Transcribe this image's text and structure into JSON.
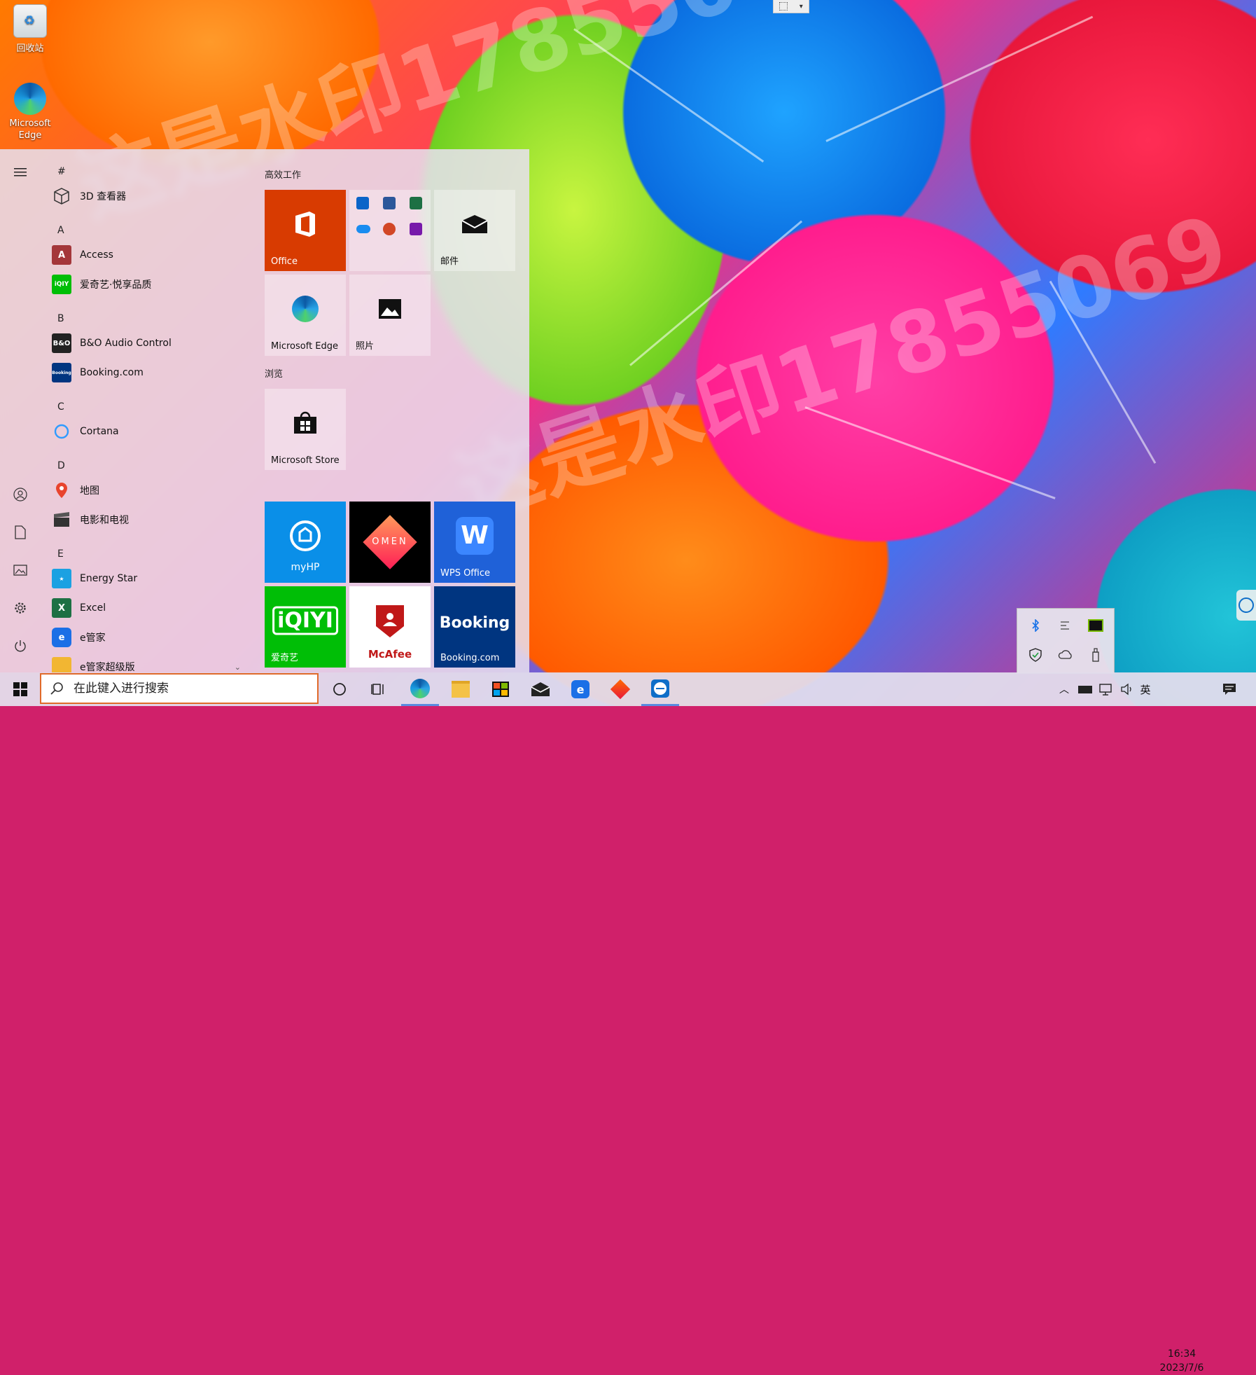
{
  "desktop": {
    "icons": [
      {
        "label": "回收站"
      },
      {
        "label": "Microsoft Edge"
      }
    ],
    "watermark_text": "这是水印17855069"
  },
  "start_menu": {
    "app_list": {
      "groups": [
        {
          "letter": "#",
          "apps": [
            {
              "label": "3D 查看器",
              "icon": "cube-icon"
            }
          ]
        },
        {
          "letter": "A",
          "apps": [
            {
              "label": "Access",
              "icon": "access-icon"
            },
            {
              "label": "爱奇艺·悦享品质",
              "icon": "iqiyi-icon"
            }
          ]
        },
        {
          "letter": "B",
          "apps": [
            {
              "label": "B&O Audio Control",
              "icon": "bo-icon"
            },
            {
              "label": "Booking.com",
              "icon": "booking-icon"
            }
          ]
        },
        {
          "letter": "C",
          "apps": [
            {
              "label": "Cortana",
              "icon": "cortana-icon"
            }
          ]
        },
        {
          "letter": "D",
          "apps": [
            {
              "label": "地图",
              "icon": "map-pin-icon"
            },
            {
              "label": "电影和电视",
              "icon": "clapper-icon"
            }
          ]
        },
        {
          "letter": "E",
          "apps": [
            {
              "label": "Energy Star",
              "icon": "energy-star-icon"
            },
            {
              "label": "Excel",
              "icon": "excel-icon"
            },
            {
              "label": "e管家",
              "icon": "eguanjia-icon"
            },
            {
              "label": "e管家超级版",
              "icon": "folder-icon"
            }
          ]
        }
      ]
    },
    "tile_groups": [
      {
        "title": "高效工作"
      },
      {
        "title": "浏览"
      }
    ],
    "tiles": {
      "office": "Office",
      "mail": "邮件",
      "edge": "Microsoft Edge",
      "photos": "照片",
      "store": "Microsoft Store",
      "myhp": "myHP",
      "omen": "OMEN",
      "wps": "WPS Office",
      "iqiyi": "爱奇艺",
      "iqiyi_logo": "iQIYI",
      "mcafee": "McAfee",
      "booking_logo": "Booking",
      "booking": "Booking.com"
    }
  },
  "taskbar": {
    "search_placeholder": "在此键入进行搜索",
    "ime": "英",
    "time": "16:34",
    "date": "2023/7/6"
  },
  "colors": {
    "office_tile": "#d83b01",
    "myhp_tile": "#0a8fe8",
    "omen_tile": "#000000",
    "wps_tile": "#1f61d8",
    "iqiyi_tile": "#00be06",
    "booking_tile": "#003580",
    "search_border": "#e06a2a"
  }
}
